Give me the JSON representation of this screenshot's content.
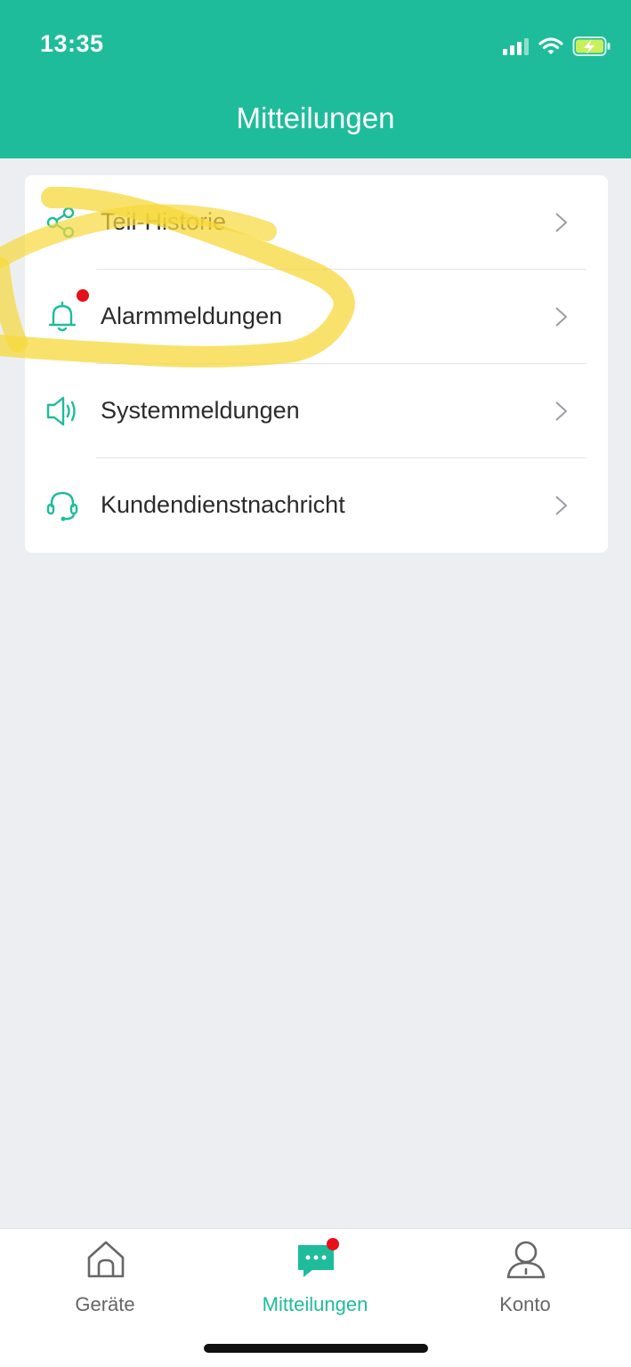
{
  "status_bar": {
    "time": "13:35",
    "icons": [
      "signal-icon",
      "wifi-icon",
      "battery-charging-icon"
    ]
  },
  "header": {
    "title": "Mitteilungen"
  },
  "menu": {
    "items": [
      {
        "label": "Teil-Historie",
        "icon": "share-icon",
        "badge": false
      },
      {
        "label": "Alarmmeldungen",
        "icon": "bell-icon",
        "badge": true
      },
      {
        "label": "Systemmeldungen",
        "icon": "speaker-icon",
        "badge": false
      },
      {
        "label": "Kundendienstnachricht",
        "icon": "headset-icon",
        "badge": false
      }
    ]
  },
  "tabbar": {
    "tabs": [
      {
        "label": "Geräte",
        "icon": "home-icon",
        "active": false
      },
      {
        "label": "Mitteilungen",
        "icon": "chat-icon",
        "active": true,
        "badge": true
      },
      {
        "label": "Konto",
        "icon": "user-icon",
        "active": false
      }
    ]
  },
  "colors": {
    "accent": "#1fbc9b",
    "badge": "#e5101a",
    "highlight": "#f7d83a",
    "background": "#eceef1"
  }
}
